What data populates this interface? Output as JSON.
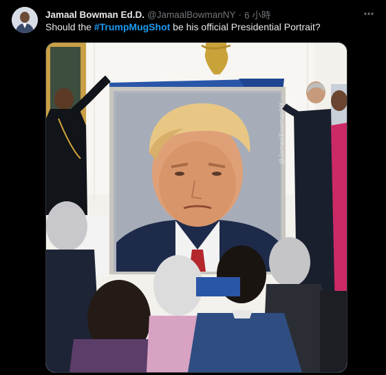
{
  "author": {
    "display_name": "Jamaal Bowman Ed.D.",
    "handle": "@JamaalBowmanNY",
    "separator": "·",
    "timestamp": "6 小時"
  },
  "tweet": {
    "text_before": "Should the ",
    "hashtag": "#TrumpMugShot",
    "text_after": " be his official Presidential Portrait?"
  },
  "media": {
    "watermark": "@JamaalBowmanNY"
  },
  "icons": {
    "more": "more-horizontal-icon",
    "avatar": "avatar"
  },
  "colors": {
    "background": "#000000",
    "text": "#e7e9ea",
    "secondary": "#71767b",
    "link": "#1d9bf0"
  }
}
